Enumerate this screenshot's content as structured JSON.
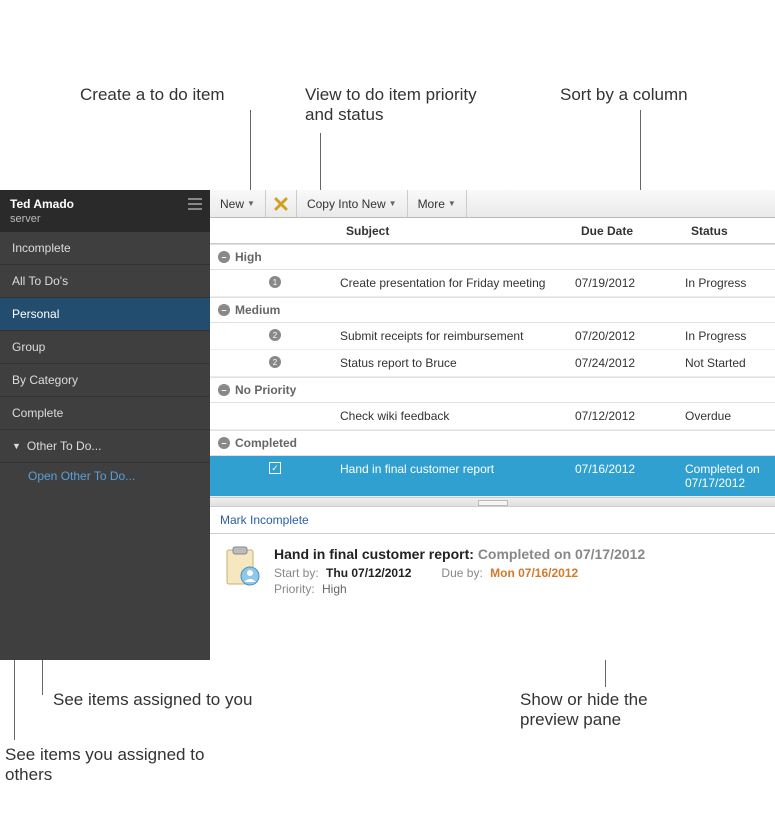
{
  "annotations": {
    "create": "Create a to do item",
    "view_priority": "View to do item priority and status",
    "sort": "Sort by a column",
    "assigned_to_you": "See items assigned to you",
    "assigned_to_others": "See items you assigned to others",
    "preview_toggle": "Show or hide the preview pane"
  },
  "sidebar": {
    "user": "Ted Amado",
    "server": "server",
    "items": [
      {
        "label": "Incomplete"
      },
      {
        "label": "All To Do's"
      },
      {
        "label": "Personal",
        "selected": true
      },
      {
        "label": "Group"
      },
      {
        "label": "By Category"
      },
      {
        "label": "Complete"
      }
    ],
    "other_label": "Other To Do...",
    "other_open": "Open Other To Do..."
  },
  "toolbar": {
    "new": "New",
    "copy": "Copy Into New",
    "more": "More"
  },
  "columns": {
    "subject": "Subject",
    "due": "Due Date",
    "status": "Status"
  },
  "groups": {
    "high": {
      "label": "High",
      "rows": [
        {
          "priority": "1",
          "subject": "Create presentation for Friday meeting",
          "due": "07/19/2012",
          "status": "In Progress"
        }
      ]
    },
    "medium": {
      "label": "Medium",
      "rows": [
        {
          "priority": "2",
          "subject": "Submit receipts for reimbursement",
          "due": "07/20/2012",
          "status": "In Progress"
        },
        {
          "priority": "2",
          "subject": "Status report to Bruce",
          "due": "07/24/2012",
          "status": "Not Started"
        }
      ]
    },
    "none": {
      "label": "No Priority",
      "rows": [
        {
          "priority": "",
          "subject": "Check wiki feedback",
          "due": "07/12/2012",
          "status": "Overdue"
        }
      ]
    },
    "completed": {
      "label": "Completed",
      "rows": [
        {
          "priority": "✓",
          "subject": "Hand in final customer report",
          "due": "07/16/2012",
          "status": "Completed on 07/17/2012"
        }
      ]
    }
  },
  "preview": {
    "mark_incomplete": "Mark Incomplete",
    "title": "Hand in final customer report:",
    "completed": "Completed on 07/17/2012",
    "start_lbl": "Start by:",
    "start_val": "Thu 07/12/2012",
    "due_lbl": "Due by:",
    "due_val": "Mon 07/16/2012",
    "priority_lbl": "Priority:",
    "priority_val": "High"
  }
}
